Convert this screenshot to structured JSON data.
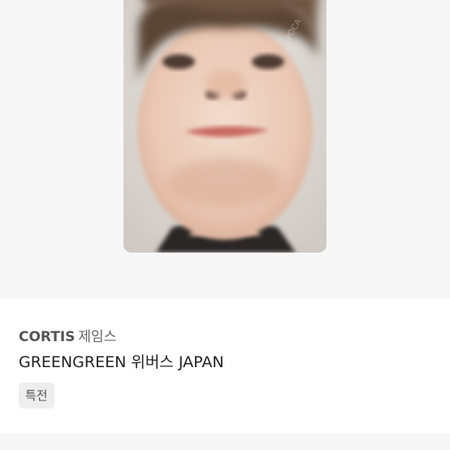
{
  "listing": {
    "brand": "CORTIS",
    "member": "제임스",
    "subtitle": "GREENGREEN 위버스 JAPAN",
    "tag": "특전"
  },
  "photo": {
    "watermark": "POCA"
  },
  "colors": {
    "background": "#f7f7f7",
    "card": "#ffffff",
    "tag_bg": "#eeeeee",
    "title_text": "#555555",
    "subtitle_text": "#222222"
  }
}
